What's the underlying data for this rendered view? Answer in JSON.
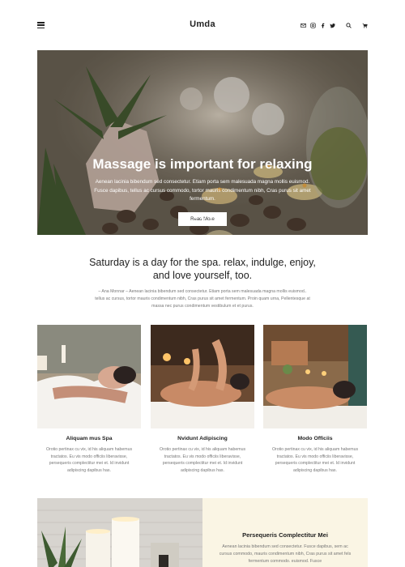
{
  "header": {
    "logo": "Umda",
    "icons": [
      "menu-icon",
      "email-icon",
      "instagram-icon",
      "facebook-icon",
      "twitter-icon",
      "search-icon",
      "cart-icon"
    ]
  },
  "hero": {
    "title": "Massage is important for relaxing",
    "text": "Aenean lacinia bibendum sed consectetur. Etiam porta sem malesuada magna mollis euismod. Fusce dapibus, tellus ac cursus commodo, tortor mauris condimentum nibh, Cras purus sit amet fermentum.",
    "button": "Read More",
    "slides": 3,
    "active_slide": 2
  },
  "intro": {
    "title": "Saturday is a day for the spa. relax, indulge, enjoy, and love yourself, too.",
    "text": "– Ana Monnar – Aenean lacinia bibendum sed consectetur. Etiam porta sem malesuada magna mollis euismod.. tellus ac cursus, tortor mauris condimentum nibh, Cras purus sit amet fermentum. Proin quam urna, Pellentesque at massa nec purus condimentum vestibulum et et purus."
  },
  "cards": [
    {
      "title": "Aliquam mus Spa",
      "text": "Orotio pertinax cu vix, id his aliquam habemus tractatos. Eu vis modo officiis liberavisse, persequeris complectitur mei et. Id invidunt adipiscing dapibus has."
    },
    {
      "title": "Nvidunt Adipiscing",
      "text": "Orotio pertinax cu vix, id his aliquam habemus tractatos. Eu vis modo officiis liberavisse, persequeris complectitur mei et. Id invidunt adipiscing dapibus has."
    },
    {
      "title": "Modo Officiis",
      "text": "Orotio pertinax cu vix, id his aliquam habemus tractatos. Eu vis modo officiis liberavisse, persequeris complectitur mei et. Id invidunt adipiscing dapibus has."
    }
  ],
  "feature": {
    "title": "Persequeris Complectitur Mei",
    "text": "Aenean lacinia bibendum sed consectetur. Fusce dapibus, sem ac cursus commodo, mauris condimentum nibh, Cras purus sit amet fels fermentum commodo. euismod. Fusce"
  },
  "colors": {
    "feature_bg": "#faf5e4",
    "text_dark": "#222222",
    "text_muted": "#777777"
  }
}
